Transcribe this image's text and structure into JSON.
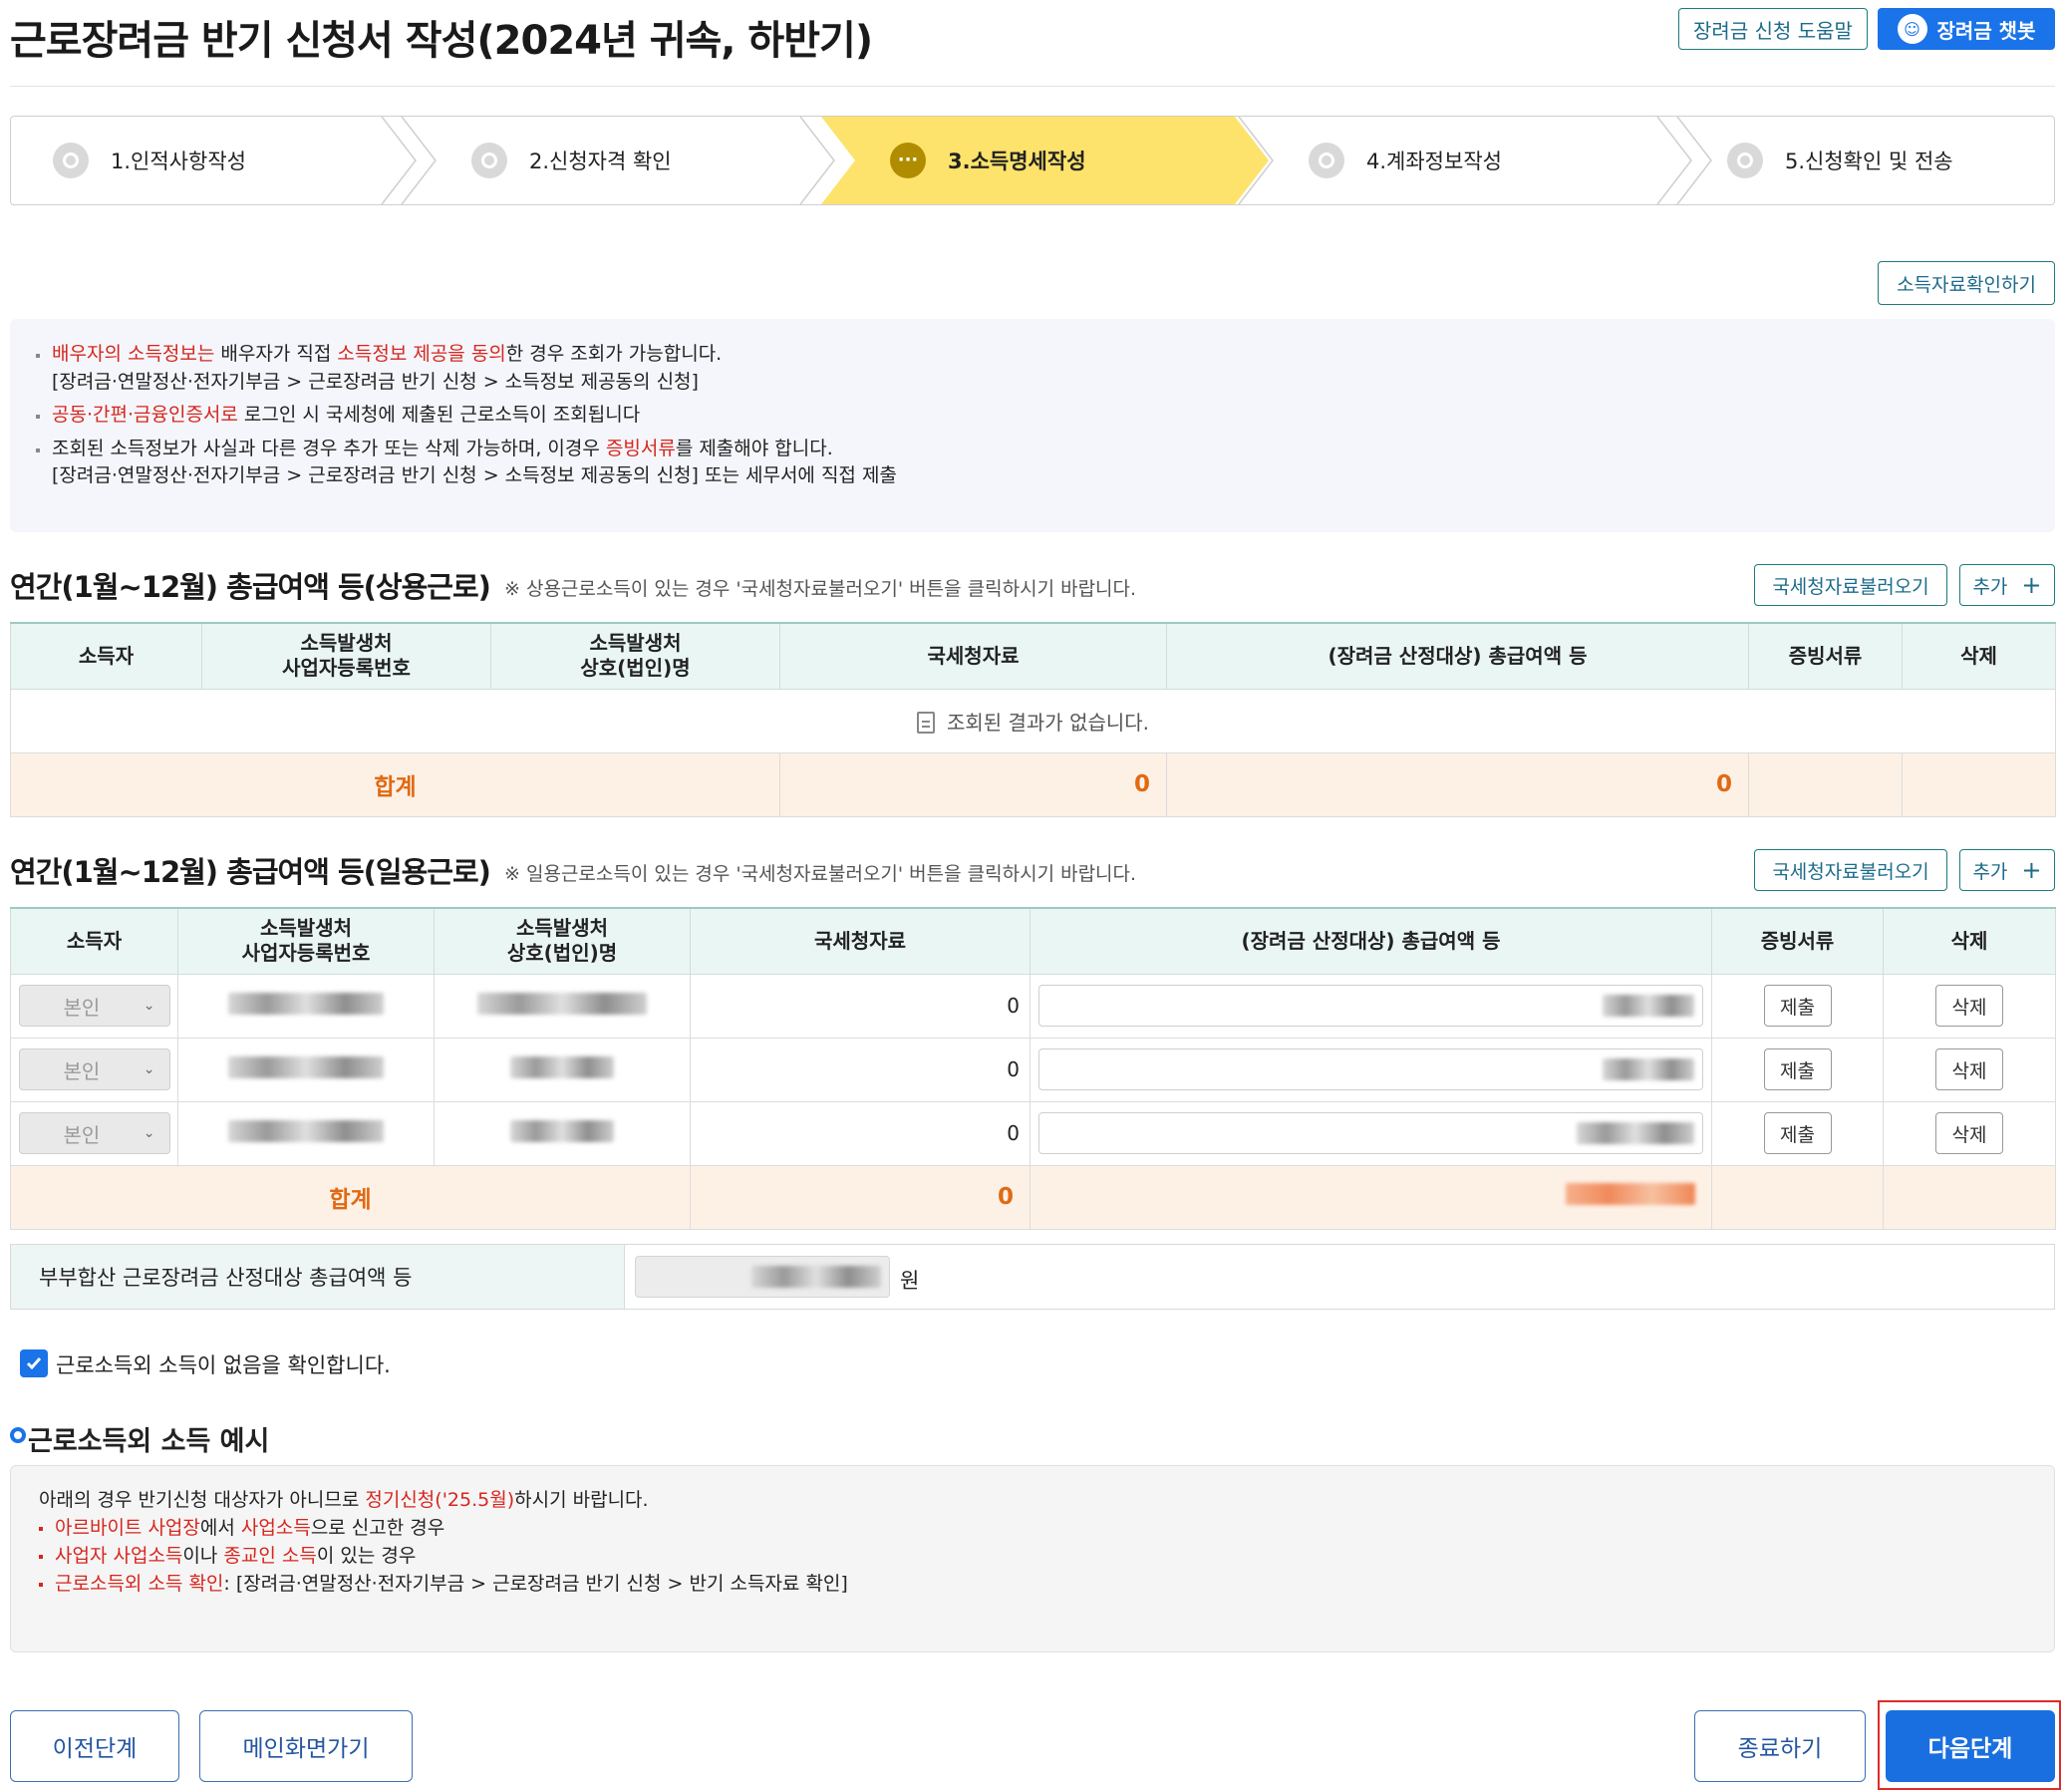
{
  "header": {
    "title": "근로장려금 반기 신청서 작성(2024년 귀속, 하반기)",
    "help_button": "장려금 신청 도움말",
    "chatbot_button": "장려금 챗봇"
  },
  "steps": [
    {
      "label": "1.인적사항작성",
      "state": "done"
    },
    {
      "label": "2.신청자격 확인",
      "state": "done"
    },
    {
      "label": "3.소득명세작성",
      "state": "active"
    },
    {
      "label": "4.계좌정보작성",
      "state": "todo"
    },
    {
      "label": "5.신청확인 및 전송",
      "state": "todo"
    }
  ],
  "income_check_button": "소득자료확인하기",
  "notice": {
    "l1_red1": "배우자의 소득정보는",
    "l1_text1": " 배우자가 직접 ",
    "l1_red2": "소득정보 제공을 동의",
    "l1_text2": "한 경우 조회가 가능합니다.",
    "l1_sub": "[장려금·연말정산·전자기부금 > 근로장려금 반기 신청 > 소득정보 제공동의 신청]",
    "l2_red": "공동·간편·금융인증서로",
    "l2_text": " 로그인 시 국세청에 제출된 근로소득이 조회됩니다",
    "l3_text1": "조회된 소득정보가 사실과 다른 경우 추가 또는 삭제 가능하며, 이경우 ",
    "l3_red": "증빙서류",
    "l3_text2": "를 제출해야 합니다.",
    "l3_sub": "[장려금·연말정산·전자기부금 > 근로장려금 반기 신청 > 소득정보 제공동의 신청] 또는 세무서에 직접 제출"
  },
  "regular": {
    "title": "연간(1월~12월) 총급여액 등(상용근로)",
    "note": "※ 상용근로소득이 있는 경우 '국세청자료불러오기' 버튼을 클릭하시기 바랍니다.",
    "load_button": "국세청자료불러오기",
    "add_button": "추가",
    "columns": [
      "소득자",
      "소득발생처 사업자등록번호",
      "소득발생처 상호(법인)명",
      "국세청자료",
      "(장려금 산정대상) 총급여액 등",
      "증빙서류",
      "삭제"
    ],
    "col_bizno_1": "소득발생처",
    "col_bizno_2": "사업자등록번호",
    "col_name_1": "소득발생처",
    "col_name_2": "상호(법인)명",
    "empty_message": "조회된 결과가 없습니다.",
    "sum_label": "합계",
    "sum_nts": "0",
    "sum_total": "0"
  },
  "daily": {
    "title": "연간(1월~12월) 총급여액 등(일용근로)",
    "note": "※ 일용근로소득이 있는 경우 '국세청자료불러오기' 버튼을 클릭하시기 바랍니다.",
    "load_button": "국세청자료불러오기",
    "add_button": "추가",
    "columns": [
      "소득자",
      "소득발생처 사업자등록번호",
      "소득발생처 상호(법인)명",
      "국세청자료",
      "(장려금 산정대상) 총급여액 등",
      "증빙서류",
      "삭제"
    ],
    "col_bizno_1": "소득발생처",
    "col_bizno_2": "사업자등록번호",
    "col_name_1": "소득발생처",
    "col_name_2": "상호(법인)명",
    "rows": [
      {
        "earner": "본인",
        "nts": "0",
        "submit": "제출",
        "delete": "삭제"
      },
      {
        "earner": "본인",
        "nts": "0",
        "submit": "제출",
        "delete": "삭제"
      },
      {
        "earner": "본인",
        "nts": "0",
        "submit": "제출",
        "delete": "삭제"
      }
    ],
    "sum_label": "합계",
    "sum_nts": "0"
  },
  "couple": {
    "label": "부부합산 근로장려금 산정대상 총급여액 등",
    "unit": "원"
  },
  "confirm_checkbox": {
    "label": "근로소득외 소득이 없음을 확인합니다.",
    "checked": true
  },
  "example": {
    "title": "근로소득외 소득 예시",
    "intro_text1": "아래의 경우 반기신청 대상자가 아니므로 ",
    "intro_red": "정기신청('25.5월)",
    "intro_text2": "하시기 바랍니다.",
    "b1_red1": "아르바이트 사업장",
    "b1_text1": "에서 ",
    "b1_red2": "사업소득",
    "b1_text2": "으로 신고한 경우",
    "b2_red1": "사업자 사업소득",
    "b2_text1": "이나 ",
    "b2_red2": "종교인 소득",
    "b2_text2": "이 있는 경우",
    "b3_red": "근로소득외 소득 확인",
    "b3_text": ": [장려금·연말정산·전자기부금 > 근로장려금 반기 신청 > 반기 소득자료 확인]"
  },
  "footer": {
    "prev": "이전단계",
    "main": "메인화면가기",
    "exit": "종료하기",
    "next": "다음단계"
  },
  "colors": {
    "accent": "#1a73e8",
    "active_step": "#fde36b",
    "red": "#d7261e",
    "sum_text": "#e06a14"
  }
}
